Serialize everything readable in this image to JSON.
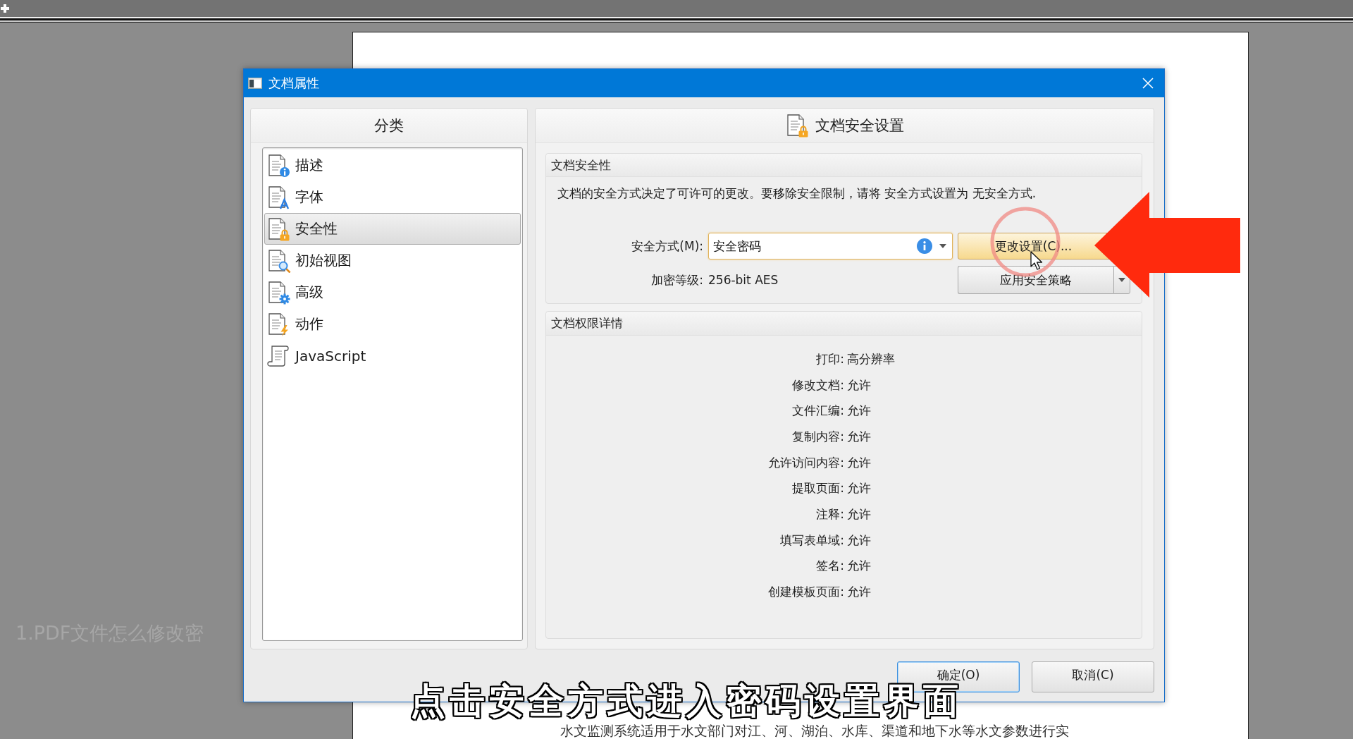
{
  "dialog": {
    "title": "文档属性",
    "category_panel": {
      "heading": "分类",
      "items": [
        {
          "label": "描述",
          "selected": false
        },
        {
          "label": "字体",
          "selected": false
        },
        {
          "label": "安全性",
          "selected": true
        },
        {
          "label": "初始视图",
          "selected": false
        },
        {
          "label": "高级",
          "selected": false
        },
        {
          "label": "动作",
          "selected": false
        },
        {
          "label": "JavaScript",
          "selected": false
        }
      ]
    },
    "settings_panel": {
      "heading": "文档安全设置",
      "security_group": {
        "title": "文档安全性",
        "description": "文档的安全方式决定了可许可的更改。要移除安全限制，请将 安全方式设置为 无安全方式.",
        "method": {
          "label": "安全方式(M):",
          "value": "安全密码",
          "focused": true
        },
        "encryption": {
          "label": "加密等级:",
          "value": "256-bit AES"
        },
        "change_button": {
          "label": "更改设置(C)...",
          "hovered": true
        },
        "policy_button": {
          "label": "应用安全策略"
        }
      },
      "permissions_group": {
        "title": "文档权限详情",
        "rows": [
          {
            "name": "打印:",
            "value": "高分辨率"
          },
          {
            "name": "修改文档:",
            "value": "允许"
          },
          {
            "name": "文件汇编:",
            "value": "允许"
          },
          {
            "name": "复制内容:",
            "value": "允许"
          },
          {
            "name": "允许访问内容:",
            "value": "允许"
          },
          {
            "name": "提取页面:",
            "value": "允许"
          },
          {
            "name": "注释:",
            "value": "允许"
          },
          {
            "name": "填写表单域:",
            "value": "允许"
          },
          {
            "name": "签名:",
            "value": "允许"
          },
          {
            "name": "创建模板页面:",
            "value": "允许"
          }
        ]
      }
    },
    "buttons": [
      {
        "label": "确定(O)",
        "default": true
      },
      {
        "label": "取消(C)",
        "default": false
      }
    ]
  },
  "caption": "1.PDF文件怎么修改密",
  "subtitle": "点击安全方式进入密码设置界面",
  "document_text": "水文监测系统适用于水文部门对江、河、湖泊、水库、渠道和地下水等水文参数进行实"
}
